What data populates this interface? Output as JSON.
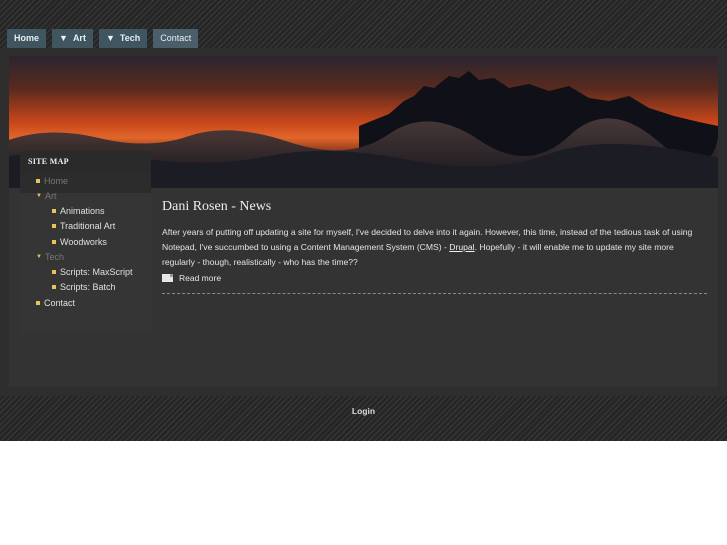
{
  "nav": {
    "items": [
      {
        "label": "Home",
        "has_arrow": false
      },
      {
        "label": "Art",
        "has_arrow": true
      },
      {
        "label": "Tech",
        "has_arrow": true
      },
      {
        "label": "Contact",
        "has_arrow": false
      }
    ],
    "arrow_glyph": "▼"
  },
  "sidebar": {
    "title": "SITE MAP",
    "items": [
      {
        "label": "Home"
      },
      {
        "label": "Art"
      },
      {
        "label": "Animations"
      },
      {
        "label": "Traditional Art"
      },
      {
        "label": "Woodworks"
      },
      {
        "label": "Tech"
      },
      {
        "label": "Scripts: MaxScript"
      },
      {
        "label": "Scripts: Batch"
      },
      {
        "label": "Contact"
      }
    ]
  },
  "article": {
    "title": "Dani Rosen - News",
    "body_before_link": "After years of putting off updating a site for myself, I've decided to delve into it again. However, this time, instead of the tedious task of using Notepad, I've succumbed to using a Content Management System (CMS) - ",
    "link_text": "Drupal",
    "body_after_link": ". Hopefully - it will enable me to update my site more regularly - though, realistically - who has the time??",
    "read_more": "Read more"
  },
  "footer": {
    "login": "Login"
  },
  "colors": {
    "nav_bg": "#3f5560",
    "bullet": "#e8c458",
    "sky_glow": "#c8461a"
  },
  "icons": {
    "nav_arrow": "triangle-down-icon",
    "read_more": "document-icon",
    "bullet": "square-bullet-icon"
  }
}
